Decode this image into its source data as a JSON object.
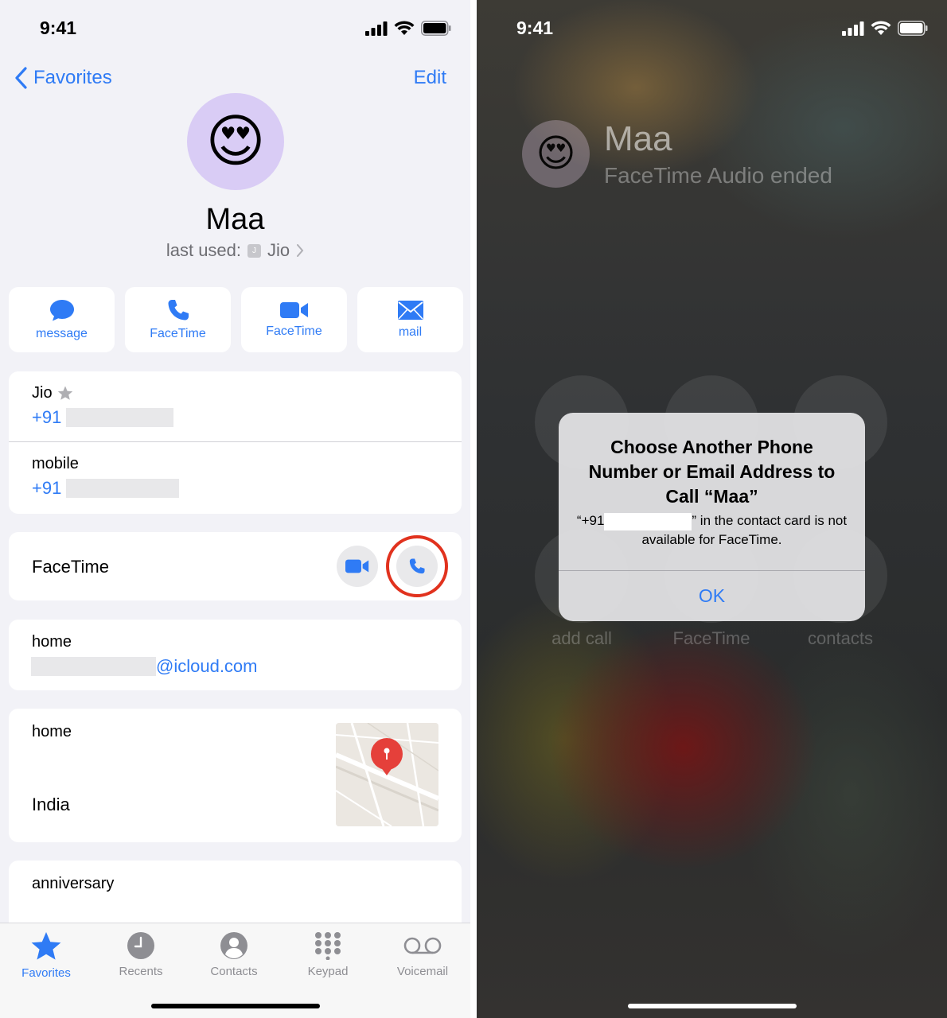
{
  "left": {
    "status": {
      "time": "9:41"
    },
    "nav": {
      "back_label": "Favorites",
      "edit_label": "Edit"
    },
    "contact": {
      "name": "Maa",
      "avatar_emoji": "😍",
      "last_used_label": "last used:",
      "last_used_sim_letter": "J",
      "last_used_value": "Jio",
      "avatar_bg": "#d9ccf5"
    },
    "actions": [
      {
        "label": "message",
        "icon": "message-bubble-icon"
      },
      {
        "label": "FaceTime",
        "icon": "phone-icon"
      },
      {
        "label": "FaceTime",
        "icon": "video-camera-icon"
      },
      {
        "label": "mail",
        "icon": "envelope-icon"
      }
    ],
    "phones": [
      {
        "label": "Jio",
        "value": "+91",
        "favorite": true
      },
      {
        "label": "mobile",
        "value": "+91"
      }
    ],
    "facetime_row": {
      "label": "FaceTime"
    },
    "email": {
      "label": "home",
      "value": "@icloud.com"
    },
    "address": {
      "label": "home",
      "value": "India"
    },
    "anniversary": {
      "label": "anniversary"
    },
    "tabs": [
      {
        "label": "Favorites",
        "icon": "star-icon",
        "active": true
      },
      {
        "label": "Recents",
        "icon": "clock-icon"
      },
      {
        "label": "Contacts",
        "icon": "person-circle-icon"
      },
      {
        "label": "Keypad",
        "icon": "keypad-icon"
      },
      {
        "label": "Voicemail",
        "icon": "voicemail-icon"
      }
    ],
    "accent": "#2f7bf5",
    "highlight_ring": "#e1321e"
  },
  "right": {
    "status": {
      "time": "9:41"
    },
    "call": {
      "name": "Maa",
      "status": "FaceTime Audio ended",
      "avatar_emoji": "😍"
    },
    "controls": [
      {
        "label": "add call"
      },
      {
        "label": "FaceTime"
      },
      {
        "label": "contacts"
      }
    ],
    "alert": {
      "title": "Choose Another Phone Number or Email Address to Call “Maa”",
      "msg_prefix": "“+91",
      "msg_suffix": "” in the contact card is not available for FaceTime.",
      "ok_label": "OK"
    }
  }
}
